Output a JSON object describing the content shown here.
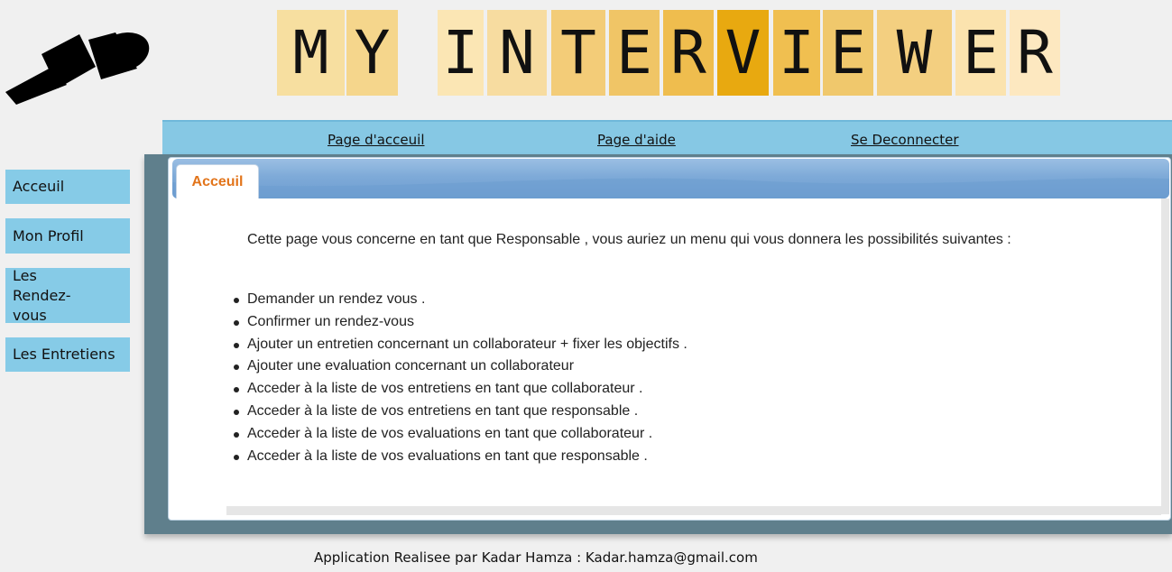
{
  "header": {
    "logo_icon": "microphone-icon",
    "title_letters": [
      "M",
      "Y",
      "I",
      "N",
      "T",
      "E",
      "R",
      "V",
      "I",
      "E",
      "W",
      "E",
      "R"
    ],
    "title_colors": [
      "#f7dfa0",
      "#f5d68c",
      "#fbe6b4",
      "#f7dca0",
      "#f3cc78",
      "#f0c566",
      "#efbd4e",
      "#e8a910",
      "#f0bf50",
      "#f0c86c",
      "#f3cf80",
      "#fbe3ae",
      "#fde8c0"
    ]
  },
  "topnav": {
    "home": "Page d'acceuil",
    "help": "Page d'aide",
    "logout": "Se Deconnecter"
  },
  "sidebar": {
    "items": [
      {
        "label": "Acceuil"
      },
      {
        "label": "Mon Profil"
      },
      {
        "label": "Les Rendez-vous"
      },
      {
        "label": "Les Entretiens"
      }
    ]
  },
  "main": {
    "tab_label": "Acceuil",
    "intro": "Cette page vous concerne en tant que Responsable , vous auriez un menu qui vous donnera les possibilités suivantes :",
    "features": [
      "Demander un rendez vous .",
      "Confirmer un rendez-vous",
      "Ajouter un entretien concernant un collaborateur + fixer les objectifs .",
      "Ajouter une evaluation concernant un collaborateur",
      "Acceder à la liste de vos entretiens en tant que collaborateur .",
      "Acceder à la liste de vos entretiens en tant que responsable .",
      "Acceder à la liste de vos evaluations en tant que collaborateur .",
      "Acceder à la liste de vos evaluations en tant que responsable ."
    ]
  },
  "footer": {
    "text": "Application Realisee par Kadar Hamza : Kadar.hamza@gmail.com"
  }
}
